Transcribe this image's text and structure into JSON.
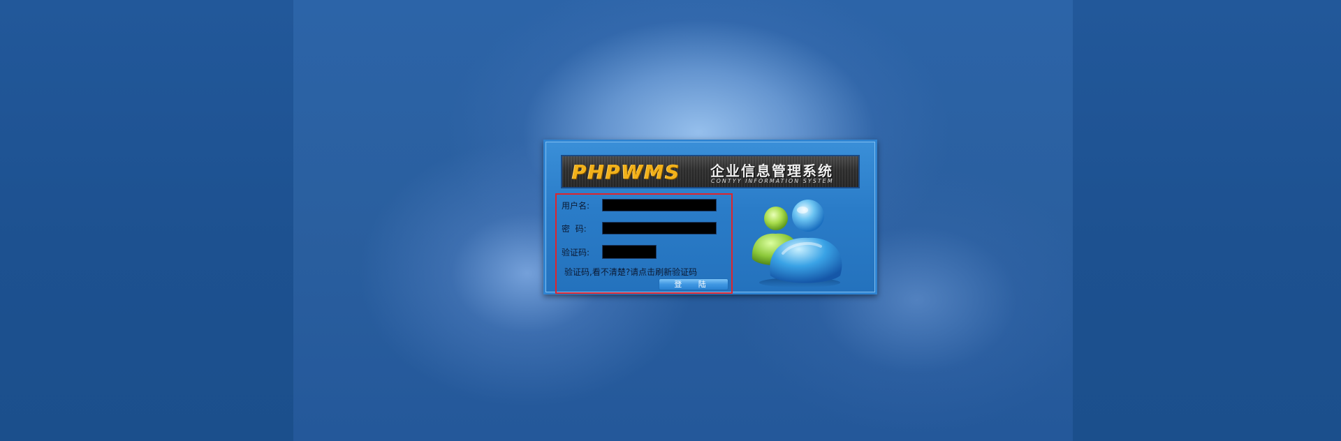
{
  "banner": {
    "logo_text": "PHPWMS",
    "title": "企业信息管理系统",
    "subtitle": "CONTYY INFORMATION SYSTEM"
  },
  "form": {
    "username_label": "用户名:",
    "password_label": "密  码:",
    "captcha_label": "验证码:",
    "username_value": "",
    "password_value": "",
    "captcha_value": "",
    "captcha_hint": "验证码,看不清楚?请点击刷新验证码",
    "login_button": "登 陆"
  },
  "icons": {
    "users": "users-icon"
  },
  "colors": {
    "panel_blue": "#2a7cc8",
    "highlight_border": "#e0242b",
    "logo_gold": "#f2b11a",
    "input_fill": "#000000"
  }
}
